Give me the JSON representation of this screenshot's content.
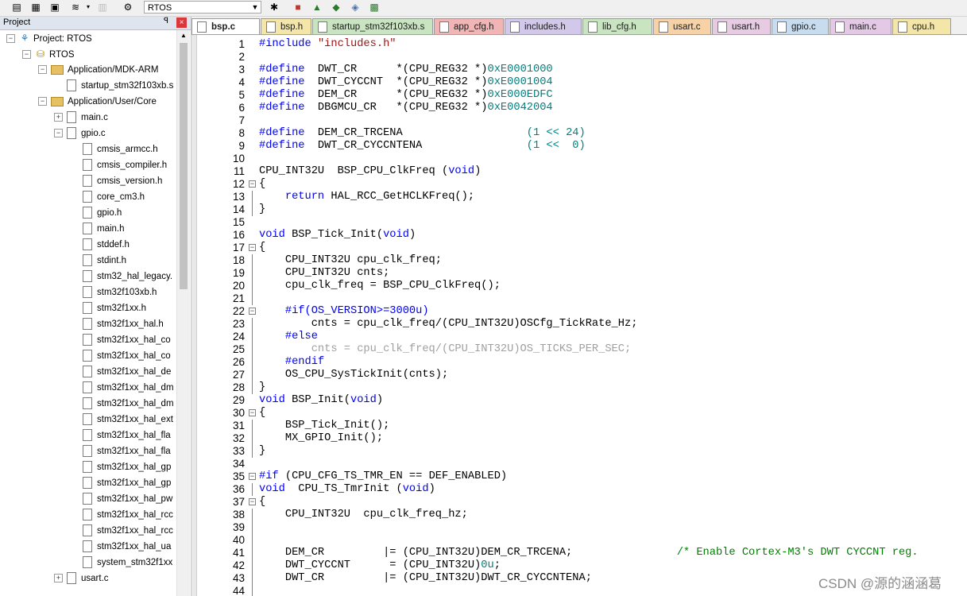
{
  "toolbar": {
    "target_combo": "RTOS",
    "icons": [
      "save-all-icon",
      "print-icon",
      "save-icon",
      "stack-icon",
      "dropdown-icon",
      "disabled-icon",
      "configure-icon",
      "target-options-icon",
      "manage-icon",
      "components-icon",
      "download-icon",
      "pack-installer-icon"
    ]
  },
  "project_panel": {
    "title": "Project",
    "pin": "Ǝ",
    "close": "×",
    "tree": [
      {
        "indent": 0,
        "toggle": "−",
        "kind": "project",
        "label": "Project: RTOS"
      },
      {
        "indent": 1,
        "toggle": "−",
        "kind": "target",
        "label": "RTOS"
      },
      {
        "indent": 2,
        "toggle": "−",
        "kind": "folder",
        "label": "Application/MDK-ARM"
      },
      {
        "indent": 3,
        "toggle": "",
        "kind": "file",
        "label": "startup_stm32f103xb.s"
      },
      {
        "indent": 2,
        "toggle": "−",
        "kind": "folder",
        "label": "Application/User/Core"
      },
      {
        "indent": 3,
        "toggle": "+",
        "kind": "file",
        "label": "main.c"
      },
      {
        "indent": 3,
        "toggle": "−",
        "kind": "file",
        "label": "gpio.c"
      },
      {
        "indent": 4,
        "toggle": "",
        "kind": "file",
        "label": "cmsis_armcc.h"
      },
      {
        "indent": 4,
        "toggle": "",
        "kind": "file",
        "label": "cmsis_compiler.h"
      },
      {
        "indent": 4,
        "toggle": "",
        "kind": "file",
        "label": "cmsis_version.h"
      },
      {
        "indent": 4,
        "toggle": "",
        "kind": "file",
        "label": "core_cm3.h"
      },
      {
        "indent": 4,
        "toggle": "",
        "kind": "file",
        "label": "gpio.h"
      },
      {
        "indent": 4,
        "toggle": "",
        "kind": "file",
        "label": "main.h"
      },
      {
        "indent": 4,
        "toggle": "",
        "kind": "file",
        "label": "stddef.h"
      },
      {
        "indent": 4,
        "toggle": "",
        "kind": "file",
        "label": "stdint.h"
      },
      {
        "indent": 4,
        "toggle": "",
        "kind": "file",
        "label": "stm32_hal_legacy."
      },
      {
        "indent": 4,
        "toggle": "",
        "kind": "file",
        "label": "stm32f103xb.h"
      },
      {
        "indent": 4,
        "toggle": "",
        "kind": "file",
        "label": "stm32f1xx.h"
      },
      {
        "indent": 4,
        "toggle": "",
        "kind": "file",
        "label": "stm32f1xx_hal.h"
      },
      {
        "indent": 4,
        "toggle": "",
        "kind": "file",
        "label": "stm32f1xx_hal_co"
      },
      {
        "indent": 4,
        "toggle": "",
        "kind": "file",
        "label": "stm32f1xx_hal_co"
      },
      {
        "indent": 4,
        "toggle": "",
        "kind": "file",
        "label": "stm32f1xx_hal_de"
      },
      {
        "indent": 4,
        "toggle": "",
        "kind": "file",
        "label": "stm32f1xx_hal_dm"
      },
      {
        "indent": 4,
        "toggle": "",
        "kind": "file",
        "label": "stm32f1xx_hal_dm"
      },
      {
        "indent": 4,
        "toggle": "",
        "kind": "file",
        "label": "stm32f1xx_hal_ext"
      },
      {
        "indent": 4,
        "toggle": "",
        "kind": "file",
        "label": "stm32f1xx_hal_fla"
      },
      {
        "indent": 4,
        "toggle": "",
        "kind": "file",
        "label": "stm32f1xx_hal_fla"
      },
      {
        "indent": 4,
        "toggle": "",
        "kind": "file",
        "label": "stm32f1xx_hal_gp"
      },
      {
        "indent": 4,
        "toggle": "",
        "kind": "file",
        "label": "stm32f1xx_hal_gp"
      },
      {
        "indent": 4,
        "toggle": "",
        "kind": "file",
        "label": "stm32f1xx_hal_pw"
      },
      {
        "indent": 4,
        "toggle": "",
        "kind": "file",
        "label": "stm32f1xx_hal_rcc"
      },
      {
        "indent": 4,
        "toggle": "",
        "kind": "file",
        "label": "stm32f1xx_hal_rcc"
      },
      {
        "indent": 4,
        "toggle": "",
        "kind": "file",
        "label": "stm32f1xx_hal_ua"
      },
      {
        "indent": 4,
        "toggle": "",
        "kind": "file",
        "label": "system_stm32f1xx"
      },
      {
        "indent": 3,
        "toggle": "+",
        "kind": "file",
        "label": "usart.c"
      }
    ]
  },
  "tabs": [
    {
      "label": "bsp.c",
      "active": true,
      "color": "#ffffff"
    },
    {
      "label": "bsp.h",
      "active": false,
      "color": "#f3e6a8"
    },
    {
      "label": "startup_stm32f103xb.s",
      "active": false,
      "color": "#c9e4c1"
    },
    {
      "label": "app_cfg.h",
      "active": false,
      "color": "#f2b5b5"
    },
    {
      "label": "includes.h",
      "active": false,
      "color": "#d2c8e9"
    },
    {
      "label": "lib_cfg.h",
      "active": false,
      "color": "#c9e4c1"
    },
    {
      "label": "usart.c",
      "active": false,
      "color": "#f7d2a6"
    },
    {
      "label": "usart.h",
      "active": false,
      "color": "#e6cbe3"
    },
    {
      "label": "gpio.c",
      "active": false,
      "color": "#c8dcef"
    },
    {
      "label": "main.c",
      "active": false,
      "color": "#e3c9e6"
    },
    {
      "label": "cpu.h",
      "active": false,
      "color": "#f3e6a8"
    }
  ],
  "code_lines": [
    {
      "n": "1",
      "fold": "",
      "segs": [
        {
          "c": "pp",
          "t": "#include "
        },
        {
          "c": "str",
          "t": "\"includes.h\""
        }
      ]
    },
    {
      "n": "2",
      "fold": "",
      "segs": []
    },
    {
      "n": "3",
      "fold": "",
      "segs": [
        {
          "c": "pp",
          "t": "#define"
        },
        {
          "c": "",
          "t": "  DWT_CR      *(CPU_REG32 *)"
        },
        {
          "c": "num",
          "t": "0xE0001000"
        }
      ]
    },
    {
      "n": "4",
      "fold": "",
      "segs": [
        {
          "c": "pp",
          "t": "#define"
        },
        {
          "c": "",
          "t": "  DWT_CYCCNT  *(CPU_REG32 *)"
        },
        {
          "c": "num",
          "t": "0xE0001004"
        }
      ]
    },
    {
      "n": "5",
      "fold": "",
      "segs": [
        {
          "c": "pp",
          "t": "#define"
        },
        {
          "c": "",
          "t": "  DEM_CR      *(CPU_REG32 *)"
        },
        {
          "c": "num",
          "t": "0xE000EDFC"
        }
      ]
    },
    {
      "n": "6",
      "fold": "",
      "segs": [
        {
          "c": "pp",
          "t": "#define"
        },
        {
          "c": "",
          "t": "  DBGMCU_CR   *(CPU_REG32 *)"
        },
        {
          "c": "num",
          "t": "0xE0042004"
        }
      ]
    },
    {
      "n": "7",
      "fold": "",
      "segs": []
    },
    {
      "n": "8",
      "fold": "",
      "segs": [
        {
          "c": "pp",
          "t": "#define"
        },
        {
          "c": "",
          "t": "  DEM_CR_TRCENA                   "
        },
        {
          "c": "num",
          "t": "(1 << 24)"
        }
      ]
    },
    {
      "n": "9",
      "fold": "",
      "segs": [
        {
          "c": "pp",
          "t": "#define"
        },
        {
          "c": "",
          "t": "  DWT_CR_CYCCNTENA                "
        },
        {
          "c": "num",
          "t": "(1 <<  0)"
        }
      ]
    },
    {
      "n": "10",
      "fold": "",
      "segs": []
    },
    {
      "n": "11",
      "fold": "",
      "segs": [
        {
          "c": "",
          "t": "CPU_INT32U  BSP_CPU_ClkFreq ("
        },
        {
          "c": "kw",
          "t": "void"
        },
        {
          "c": "",
          "t": ")"
        }
      ]
    },
    {
      "n": "12",
      "fold": "open",
      "segs": [
        {
          "c": "",
          "t": "{"
        }
      ]
    },
    {
      "n": "13",
      "fold": "line",
      "segs": [
        {
          "c": "",
          "t": "    "
        },
        {
          "c": "kw",
          "t": "return"
        },
        {
          "c": "",
          "t": " HAL_RCC_GetHCLKFreq();"
        }
      ]
    },
    {
      "n": "14",
      "fold": "line",
      "segs": [
        {
          "c": "",
          "t": "}"
        }
      ]
    },
    {
      "n": "15",
      "fold": "",
      "segs": []
    },
    {
      "n": "16",
      "fold": "",
      "segs": [
        {
          "c": "kw",
          "t": "void"
        },
        {
          "c": "",
          "t": " BSP_Tick_Init("
        },
        {
          "c": "kw",
          "t": "void"
        },
        {
          "c": "",
          "t": ")"
        }
      ]
    },
    {
      "n": "17",
      "fold": "open",
      "segs": [
        {
          "c": "",
          "t": "{"
        }
      ]
    },
    {
      "n": "18",
      "fold": "line",
      "segs": [
        {
          "c": "",
          "t": "    CPU_INT32U cpu_clk_freq;"
        }
      ]
    },
    {
      "n": "19",
      "fold": "line",
      "segs": [
        {
          "c": "",
          "t": "    CPU_INT32U cnts;"
        }
      ]
    },
    {
      "n": "20",
      "fold": "line",
      "segs": [
        {
          "c": "",
          "t": "    cpu_clk_freq = BSP_CPU_ClkFreq();"
        }
      ]
    },
    {
      "n": "21",
      "fold": "line",
      "segs": []
    },
    {
      "n": "22",
      "fold": "open",
      "segs": [
        {
          "c": "",
          "t": "    "
        },
        {
          "c": "pp",
          "t": "#if(OS_VERSION>=3000u)"
        }
      ]
    },
    {
      "n": "23",
      "fold": "line",
      "segs": [
        {
          "c": "",
          "t": "        cnts = cpu_clk_freq/(CPU_INT32U)OSCfg_TickRate_Hz;"
        }
      ]
    },
    {
      "n": "24",
      "fold": "line",
      "segs": [
        {
          "c": "",
          "t": "    "
        },
        {
          "c": "pp",
          "t": "#else"
        }
      ]
    },
    {
      "n": "25",
      "fold": "line",
      "segs": [
        {
          "c": "dis",
          "t": "        cnts = cpu_clk_freq/(CPU_INT32U)OS_TICKS_PER_SEC;"
        }
      ]
    },
    {
      "n": "26",
      "fold": "line",
      "segs": [
        {
          "c": "",
          "t": "    "
        },
        {
          "c": "pp",
          "t": "#endif"
        }
      ]
    },
    {
      "n": "27",
      "fold": "line",
      "segs": [
        {
          "c": "",
          "t": "    OS_CPU_SysTickInit(cnts);"
        }
      ]
    },
    {
      "n": "28",
      "fold": "line",
      "segs": [
        {
          "c": "",
          "t": "}"
        }
      ]
    },
    {
      "n": "29",
      "fold": "",
      "segs": [
        {
          "c": "kw",
          "t": "void"
        },
        {
          "c": "",
          "t": " BSP_Init("
        },
        {
          "c": "kw",
          "t": "void"
        },
        {
          "c": "",
          "t": ")"
        }
      ]
    },
    {
      "n": "30",
      "fold": "open",
      "segs": [
        {
          "c": "",
          "t": "{"
        }
      ]
    },
    {
      "n": "31",
      "fold": "line",
      "segs": [
        {
          "c": "",
          "t": "    BSP_Tick_Init();"
        }
      ]
    },
    {
      "n": "32",
      "fold": "line",
      "segs": [
        {
          "c": "",
          "t": "    MX_GPIO_Init();"
        }
      ]
    },
    {
      "n": "33",
      "fold": "line",
      "segs": [
        {
          "c": "",
          "t": "}"
        }
      ]
    },
    {
      "n": "34",
      "fold": "",
      "segs": []
    },
    {
      "n": "35",
      "fold": "open",
      "segs": [
        {
          "c": "pp",
          "t": "#if"
        },
        {
          "c": "",
          "t": " (CPU_CFG_TS_TMR_EN == DEF_ENABLED)"
        }
      ]
    },
    {
      "n": "36",
      "fold": "line",
      "segs": [
        {
          "c": "kw",
          "t": "void"
        },
        {
          "c": "",
          "t": "  CPU_TS_TmrInit ("
        },
        {
          "c": "kw",
          "t": "void"
        },
        {
          "c": "",
          "t": ")"
        }
      ]
    },
    {
      "n": "37",
      "fold": "open",
      "segs": [
        {
          "c": "",
          "t": "{"
        }
      ]
    },
    {
      "n": "38",
      "fold": "line",
      "segs": [
        {
          "c": "",
          "t": "    CPU_INT32U  cpu_clk_freq_hz;"
        }
      ]
    },
    {
      "n": "39",
      "fold": "line",
      "segs": []
    },
    {
      "n": "40",
      "fold": "line",
      "segs": []
    },
    {
      "n": "41",
      "fold": "line",
      "segs": [
        {
          "c": "",
          "t": "    DEM_CR         |= (CPU_INT32U)DEM_CR_TRCENA;                "
        },
        {
          "c": "cm",
          "t": "/* Enable Cortex-M3's DWT CYCCNT reg."
        }
      ]
    },
    {
      "n": "42",
      "fold": "line",
      "segs": [
        {
          "c": "",
          "t": "    DWT_CYCCNT      = (CPU_INT32U)"
        },
        {
          "c": "num",
          "t": "0u"
        },
        {
          "c": "",
          "t": ";"
        }
      ]
    },
    {
      "n": "43",
      "fold": "line",
      "segs": [
        {
          "c": "",
          "t": "    DWT_CR         |= (CPU_INT32U)DWT_CR_CYCCNTENA;"
        }
      ]
    },
    {
      "n": "44",
      "fold": "line",
      "segs": []
    }
  ],
  "watermark": "CSDN @源的涵涵葛"
}
